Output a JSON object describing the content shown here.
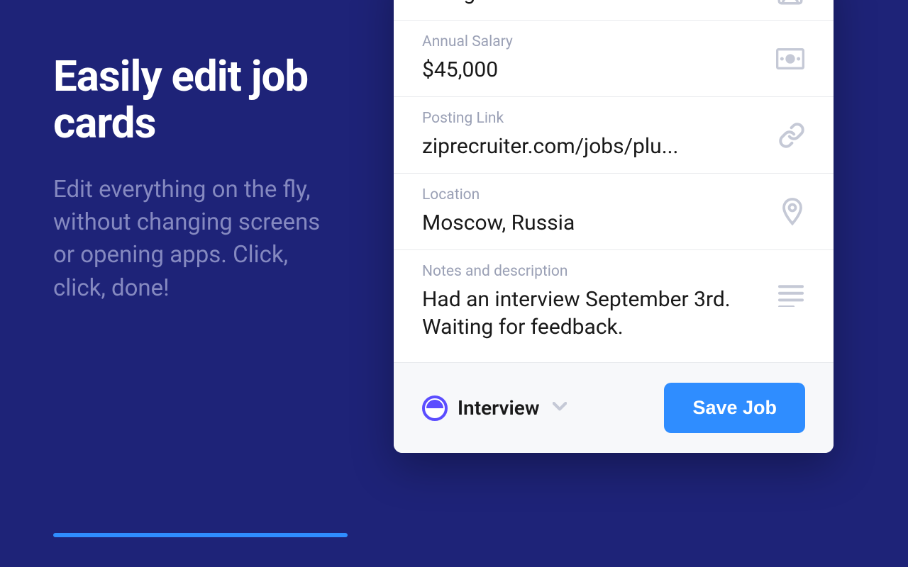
{
  "hero": {
    "heading": "Easily edit job cards",
    "subtext": "Edit everything on the fly, without changing screens or opening apps. Click, click, done!"
  },
  "card": {
    "fields": {
      "title": {
        "label": "",
        "value": "Designer"
      },
      "salary": {
        "label": "Annual Salary",
        "value": "$45,000"
      },
      "link": {
        "label": "Posting Link",
        "value": "ziprecruiter.com/jobs/plu..."
      },
      "location": {
        "label": "Location",
        "value": "Moscow, Russia"
      },
      "notes": {
        "label": "Notes and description",
        "value": "Had an interview September 3rd. Waiting for feedback."
      }
    },
    "footer": {
      "status": "Interview",
      "save_button": "Save Job"
    }
  }
}
